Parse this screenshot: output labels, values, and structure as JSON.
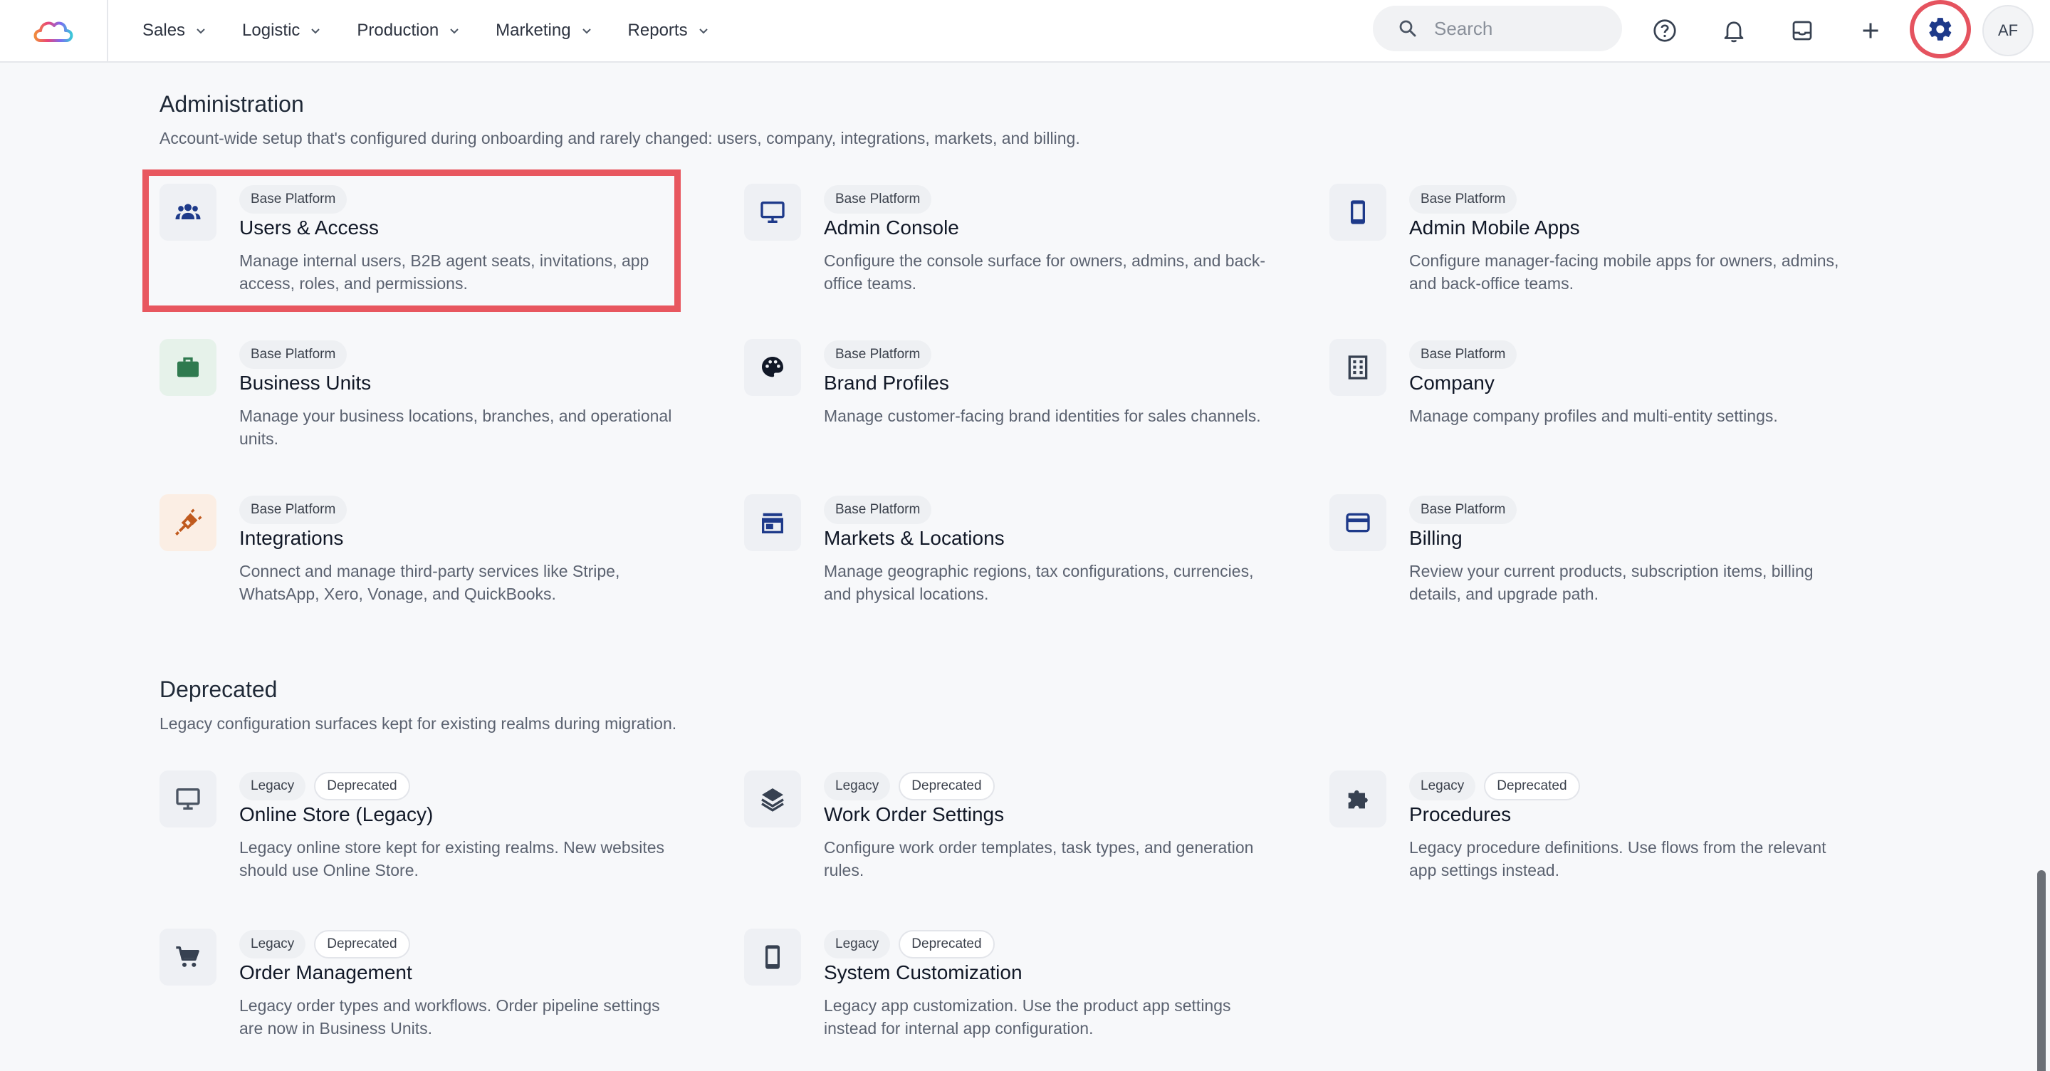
{
  "nav": {
    "items": [
      {
        "label": "Sales"
      },
      {
        "label": "Logistic"
      },
      {
        "label": "Production"
      },
      {
        "label": "Marketing"
      },
      {
        "label": "Reports"
      }
    ]
  },
  "search": {
    "placeholder": "Search"
  },
  "user": {
    "initials": "AF"
  },
  "colors": {
    "highlight": "#e8575f",
    "business_units_icon": "#2f7a4f",
    "integrations_icon": "#c05a1e",
    "nav_icon": "#1e3a8a"
  },
  "administration": {
    "title": "Administration",
    "description": "Account-wide setup that's configured during onboarding and rarely changed: users, company, integrations, markets, and billing.",
    "cards": [
      {
        "tags": [
          "Base Platform"
        ],
        "title": "Users & Access",
        "description": "Manage internal users, B2B agent seats, invitations, app access, roles, and permissions.",
        "icon": "users-icon"
      },
      {
        "tags": [
          "Base Platform"
        ],
        "title": "Admin Console",
        "description": "Configure the console surface for owners, admins, and back-office teams.",
        "icon": "monitor-icon"
      },
      {
        "tags": [
          "Base Platform"
        ],
        "title": "Admin Mobile Apps",
        "description": "Configure manager-facing mobile apps for owners, admins, and back-office teams.",
        "icon": "mobile-icon"
      },
      {
        "tags": [
          "Base Platform"
        ],
        "title": "Business Units",
        "description": "Manage your business locations, branches, and operational units.",
        "icon": "briefcase-icon"
      },
      {
        "tags": [
          "Base Platform"
        ],
        "title": "Brand Profiles",
        "description": "Manage customer-facing brand identities for sales channels.",
        "icon": "palette-icon"
      },
      {
        "tags": [
          "Base Platform"
        ],
        "title": "Company",
        "description": "Manage company profiles and multi-entity settings.",
        "icon": "building-icon"
      },
      {
        "tags": [
          "Base Platform"
        ],
        "title": "Integrations",
        "description": "Connect and manage third-party services like Stripe, WhatsApp, Xero, Vonage, and QuickBooks.",
        "icon": "plug-icon"
      },
      {
        "tags": [
          "Base Platform"
        ],
        "title": "Markets & Locations",
        "description": "Manage geographic regions, tax configurations, currencies, and physical locations.",
        "icon": "store-icon"
      },
      {
        "tags": [
          "Base Platform"
        ],
        "title": "Billing",
        "description": "Review your current products, subscription items, billing details, and upgrade path.",
        "icon": "credit-card-icon"
      }
    ]
  },
  "deprecated": {
    "title": "Deprecated",
    "description": "Legacy configuration surfaces kept for existing realms during migration.",
    "cards": [
      {
        "tags": [
          "Legacy",
          "Deprecated"
        ],
        "title": "Online Store (Legacy)",
        "description": "Legacy online store kept for existing realms. New websites should use Online Store.",
        "icon": "desktop-icon"
      },
      {
        "tags": [
          "Legacy",
          "Deprecated"
        ],
        "title": "Work Order Settings",
        "description": "Configure work order templates, task types, and generation rules.",
        "icon": "layers-icon"
      },
      {
        "tags": [
          "Legacy",
          "Deprecated"
        ],
        "title": "Procedures",
        "description": "Legacy procedure definitions. Use flows from the relevant app settings instead.",
        "icon": "puzzle-icon"
      },
      {
        "tags": [
          "Legacy",
          "Deprecated"
        ],
        "title": "Order Management",
        "description": "Legacy order types and workflows. Order pipeline settings are now in Business Units.",
        "icon": "cart-icon"
      },
      {
        "tags": [
          "Legacy",
          "Deprecated"
        ],
        "title": "System Customization",
        "description": "Legacy app customization. Use the product app settings instead for internal app configuration.",
        "icon": "mobile-icon"
      }
    ]
  }
}
